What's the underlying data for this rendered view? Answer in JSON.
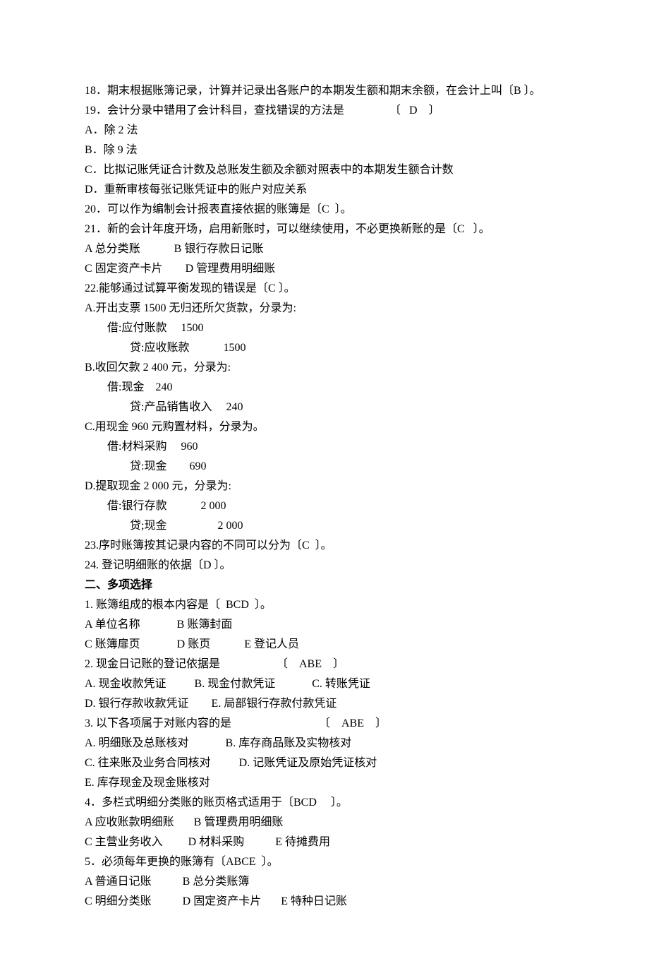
{
  "lines": [
    {
      "t": "18．期末根据账簿记录，计算并记录出各账户的本期发生额和期末余额，在会计上叫〔B 〕。",
      "cls": "line"
    },
    {
      "t": "19．会计分录中错用了会计科目，查找错误的方法是                〔   D    〕",
      "cls": "line"
    },
    {
      "t": "A．除 2 法",
      "cls": "line"
    },
    {
      "t": "B．除 9 法",
      "cls": "line"
    },
    {
      "t": "C．比拟记账凭证合计数及总账发生额及余额对照表中的本期发生额合计数",
      "cls": "line"
    },
    {
      "t": "D．重新审核每张记账凭证中的账户对应关系",
      "cls": "line"
    },
    {
      "t": "20．可以作为编制会计报表直接依据的账簿是〔C  〕。",
      "cls": "line"
    },
    {
      "t": "21．新的会计年度开场，启用新账时，可以继续使用，不必更换新账的是〔C   〕。",
      "cls": "line"
    },
    {
      "t": "A 总分类账            B 银行存款日记账",
      "cls": "line"
    },
    {
      "t": "C 固定资产卡片        D 管理费用明细账",
      "cls": "line"
    },
    {
      "t": "22.能够通过试算平衡发现的错误是〔C 〕。",
      "cls": "line"
    },
    {
      "t": "A.开出支票 1500 无归还所欠货款，分录为:",
      "cls": "line"
    },
    {
      "t": "借:应付账款     1500",
      "cls": "line indent1"
    },
    {
      "t": "贷:应收账款            1500",
      "cls": "line indent2"
    },
    {
      "t": "B.收回欠款 2 400 元，分录为:",
      "cls": "line"
    },
    {
      "t": "借:现金    240",
      "cls": "line indent1"
    },
    {
      "t": "贷:产品销售收入     240",
      "cls": "line indent2"
    },
    {
      "t": "C.用现金 960 元购置材料，分录为。",
      "cls": "line"
    },
    {
      "t": "借:材料采购     960",
      "cls": "line indent1"
    },
    {
      "t": "贷:现金        690",
      "cls": "line indent2"
    },
    {
      "t": "D.提取现金 2 000 元，分录为:",
      "cls": "line"
    },
    {
      "t": "借:银行存款            2 000",
      "cls": "line indent1"
    },
    {
      "t": "贷;现金                  2 000",
      "cls": "line indent2"
    },
    {
      "t": "23.序时账簿按其记录内容的不同可以分为〔C  〕。",
      "cls": "line"
    },
    {
      "t": "24. 登记明细账的依据〔D 〕。",
      "cls": "line"
    },
    {
      "t": "二、多项选择",
      "cls": "line bold"
    },
    {
      "t": "1. 账簿组成的根本内容是〔  BCD  〕。",
      "cls": "line"
    },
    {
      "t": "A 单位名称             B 账簿封面",
      "cls": "line"
    },
    {
      "t": "C 账簿扉页             D 账页            E 登记人员",
      "cls": "line"
    },
    {
      "t": "2. 现金日记账的登记依据是                    〔    ABE    〕",
      "cls": "line"
    },
    {
      "t": "A. 现金收款凭证          B. 现金付款凭证             C. 转账凭证",
      "cls": "line"
    },
    {
      "t": "D. 银行存款收款凭证        E. 局部银行存款付款凭证",
      "cls": "line"
    },
    {
      "t": "3. 以下各项属于对账内容的是                               〔    ABE    〕",
      "cls": "line"
    },
    {
      "t": "A. 明细账及总账核对             B. 库存商品账及实物核对",
      "cls": "line"
    },
    {
      "t": "C. 往来账及业务合同核对          D. 记账凭证及原始凭证核对",
      "cls": "line"
    },
    {
      "t": "E. 库存现金及现金账核对",
      "cls": "line"
    },
    {
      "t": "4．多栏式明细分类账的账页格式适用于〔BCD     〕。",
      "cls": "line"
    },
    {
      "t": "A 应收账款明细账       B 管理费用明细账",
      "cls": "line"
    },
    {
      "t": "C 主营业务收入         D 材料采购           E 待摊费用",
      "cls": "line"
    },
    {
      "t": "5．必须每年更换的账簿有〔ABCE  〕。",
      "cls": "line"
    },
    {
      "t": "A 普通日记账           B 总分类账簿",
      "cls": "line"
    },
    {
      "t": "C 明细分类账           D 固定资产卡片       E 特种日记账",
      "cls": "line"
    }
  ]
}
